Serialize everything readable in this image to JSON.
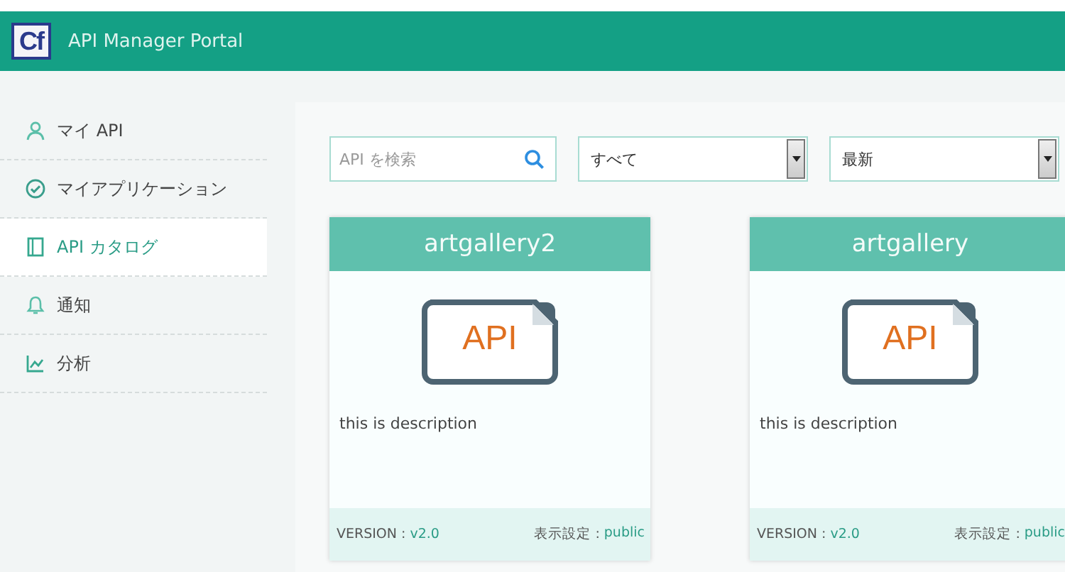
{
  "header": {
    "logo": "Cf",
    "title": "API Manager Portal"
  },
  "sidebar": {
    "items": [
      {
        "kind": "user",
        "label": "マイ API",
        "selected": false
      },
      {
        "kind": "check",
        "label": "マイアプリケーション",
        "selected": false
      },
      {
        "kind": "book",
        "label": "API カタログ",
        "selected": true
      },
      {
        "kind": "bell",
        "label": "通知",
        "selected": false
      },
      {
        "kind": "chart",
        "label": "分析",
        "selected": false
      }
    ]
  },
  "filters": {
    "search": {
      "placeholder": "API を検索"
    },
    "selects": [
      {
        "value": "すべて"
      },
      {
        "value": "最新"
      }
    ]
  },
  "cards": [
    {
      "title": "artgallery2",
      "badge": "API",
      "description": "this is description",
      "version_label": "VERSION :",
      "version": "v2.0",
      "visibility_label": "表示設定 :",
      "visibility": "public"
    },
    {
      "title": "artgallery",
      "badge": "API",
      "description": "this is description",
      "version_label": "VERSION :",
      "version": "v2.0",
      "visibility_label": "表示設定 :",
      "visibility": "public"
    }
  ]
}
